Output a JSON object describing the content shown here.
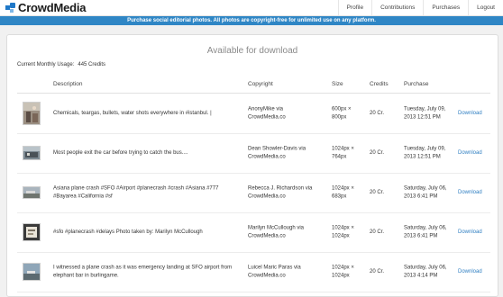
{
  "header": {
    "logo_text": "CrowdMedia",
    "nav": [
      "Profile",
      "Contributions",
      "Purchases",
      "Logout"
    ]
  },
  "banner": {
    "text": "Purchase social editorial photos. All photos are copyright-free for unlimited use on any platform."
  },
  "main": {
    "title": "Available for download",
    "usage_label": "Current Monthly Usage:",
    "usage_value": "445 Credits",
    "columns": [
      "Description",
      "Copyright",
      "Size",
      "Credits",
      "Purchase"
    ],
    "rows": [
      {
        "description": "Chemicals, teargas, bullets, water shots everywhere in #istanbul. |",
        "copyright": "AnonyMike via CrowdMedia.co",
        "size": "600px × 800px",
        "credits": "20 Cr.",
        "purchase": "Tuesday, July 09, 2013 12:51 PM",
        "action": "Download"
      },
      {
        "description": "Most people exit the car before trying to catch the bus....",
        "copyright": "Dean Showler-Davis via CrowdMedia.co",
        "size": "1024px × 764px",
        "credits": "20 Cr.",
        "purchase": "Tuesday, July 09, 2013 12:51 PM",
        "action": "Download"
      },
      {
        "description": "Asiana plane crash #SFO #Airport #planecrash #crash #Asiana #777 #Bayarea #California #sf",
        "copyright": "Rebecca J. Richardson via CrowdMedia.co",
        "size": "1024px × 683px",
        "credits": "20 Cr.",
        "purchase": "Saturday, July 06, 2013 6:41 PM",
        "action": "Download"
      },
      {
        "description": "#sfo #planecrash #delays Photo taken by: Marilyn McCullough",
        "copyright": "Marilyn McCullough via CrowdMedia.co",
        "size": "1024px × 1024px",
        "credits": "20 Cr.",
        "purchase": "Saturday, July 06, 2013 6:41 PM",
        "action": "Download"
      },
      {
        "description": "I witnessed a plane crash as it was emergency landing at SFO airport from elephant bar in burlingame.",
        "copyright": "Luicel Maric Paras via CrowdMedia.co",
        "size": "1024px × 1024px",
        "credits": "20 Cr.",
        "purchase": "Saturday, July 06, 2013 4:14 PM",
        "action": "Download"
      }
    ]
  },
  "colors": {
    "accent": "#2f86c5",
    "link": "#2f7fc2"
  }
}
